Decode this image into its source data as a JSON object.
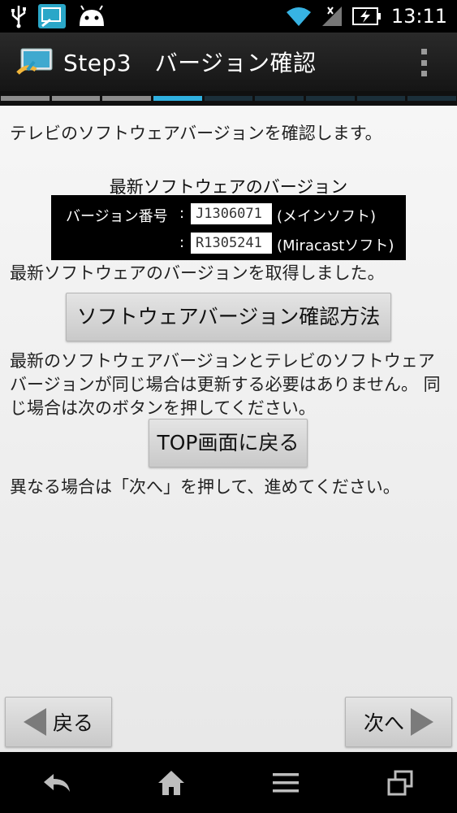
{
  "status_bar": {
    "time": "13:11",
    "icons": [
      "usb-icon",
      "screen-mirror-icon",
      "android-icon",
      "wifi-icon",
      "signal-icon",
      "battery-charging-icon"
    ]
  },
  "action_bar": {
    "title": "Step3　バージョン確認",
    "overflow_icon": "overflow-menu-icon"
  },
  "progress": {
    "total_steps": 9,
    "current_step": 4,
    "colors": {
      "done": "#8c8c8c",
      "current": "#2fb0e0",
      "pending": "#1b2f3a"
    }
  },
  "content": {
    "intro": "テレビのソフトウェアバージョンを確認します。",
    "latest_title": "最新ソフトウェアのバージョン",
    "version_label": "バージョン番号",
    "colon": ":",
    "main_version": "J1306071",
    "main_note": "(メインソフト)",
    "miracast_version": "R1305241",
    "miracast_note": "(Miracastソフト)",
    "acquired": "最新ソフトウェアのバージョンを取得しました。",
    "method_button": "ソフトウェアバージョン確認方法",
    "same_explain": "最新のソフトウェアバージョンとテレビのソフトウェアバージョンが同じ場合は更新する必要はありません。 同じ場合は次のボタンを押してください。",
    "top_button": "TOP画面に戻る",
    "different_explain": "異なる場合は「次へ」を押して、進めてください。",
    "back_button": "戻る",
    "next_button": "次へ"
  },
  "nav_bar": {
    "icons": [
      "back-icon",
      "home-icon",
      "menu-icon",
      "recent-apps-icon"
    ]
  }
}
